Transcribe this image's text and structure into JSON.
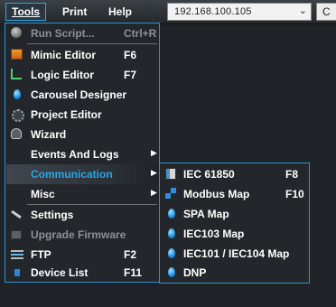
{
  "menubar": {
    "tools": "Tools",
    "print": "Print",
    "help": "Help",
    "ip_value": "192.168.100.105",
    "c_button": "C"
  },
  "tools_menu": {
    "items": [
      {
        "label": "Run Script...",
        "shortcut": "Ctrl+R",
        "icon": "disc-icon",
        "disabled": true
      },
      {
        "label": "Mimic Editor",
        "shortcut": "F6",
        "icon": "mimic-editor-icon"
      },
      {
        "label": "Logic Editor",
        "shortcut": "F7",
        "icon": "logic-editor-icon"
      },
      {
        "label": "Carousel Designer",
        "shortcut": "",
        "icon": "drop-icon"
      },
      {
        "label": "Project Editor",
        "shortcut": "",
        "icon": "gear-icon"
      },
      {
        "label": "Wizard",
        "shortcut": "",
        "icon": "wizard-icon"
      },
      {
        "label": "Events And Logs",
        "shortcut": "",
        "icon": "",
        "submenu": true
      },
      {
        "label": "Communication",
        "shortcut": "",
        "icon": "",
        "submenu": true,
        "highlighted": true
      },
      {
        "label": "Misc",
        "shortcut": "",
        "icon": "",
        "submenu": true
      },
      {
        "label": "Settings",
        "shortcut": "",
        "icon": "wrench-icon"
      },
      {
        "label": "Upgrade Firmware",
        "shortcut": "",
        "icon": "upgrade-icon",
        "disabled": true
      },
      {
        "label": "FTP",
        "shortcut": "F2",
        "icon": "ftp-icon"
      },
      {
        "label": "Device List",
        "shortcut": "F11",
        "icon": "device-list-icon"
      }
    ]
  },
  "communication_submenu": {
    "items": [
      {
        "label": "IEC 61850",
        "shortcut": "F8",
        "icon": "iec61850-icon"
      },
      {
        "label": "Modbus Map",
        "shortcut": "F10",
        "icon": "modbus-icon"
      },
      {
        "label": "SPA Map",
        "shortcut": "",
        "icon": "drop-icon"
      },
      {
        "label": "IEC103 Map",
        "shortcut": "",
        "icon": "drop-icon"
      },
      {
        "label": "IEC101 / IEC104 Map",
        "shortcut": "",
        "icon": "drop-icon"
      },
      {
        "label": "DNP",
        "shortcut": "",
        "icon": "drop-icon"
      }
    ]
  },
  "colors": {
    "background": "#1f2226",
    "menu_border": "#2d93cf",
    "highlight_text": "#2aa7e6",
    "disabled_text": "#8d9196"
  }
}
